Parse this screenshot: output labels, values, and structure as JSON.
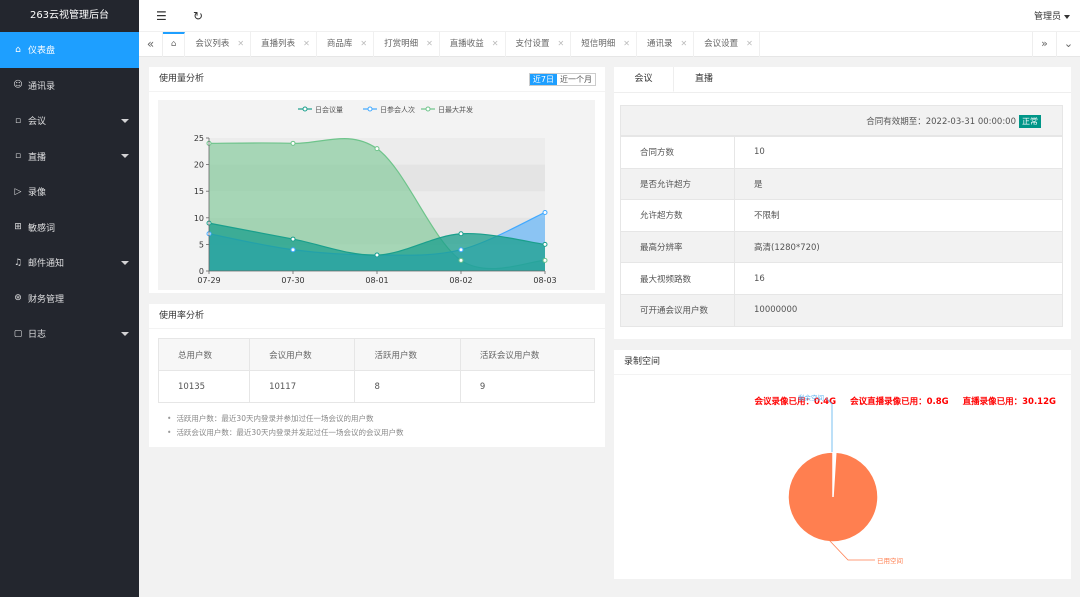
{
  "app": {
    "title": "263云视管理后台"
  },
  "sidebar": {
    "items": [
      {
        "label": "仪表盘",
        "icon": "home-icon"
      },
      {
        "label": "通讯录",
        "icon": "contacts-icon"
      },
      {
        "label": "会议",
        "icon": "meeting-icon"
      },
      {
        "label": "直播",
        "icon": "live-icon"
      },
      {
        "label": "录像",
        "icon": "video-icon"
      },
      {
        "label": "敏感词",
        "icon": "sensitive-icon"
      },
      {
        "label": "邮件通知",
        "icon": "bell-icon"
      },
      {
        "label": "财务管理",
        "icon": "finance-icon"
      },
      {
        "label": "日志",
        "icon": "log-icon"
      }
    ]
  },
  "header": {
    "user": "管理员"
  },
  "tabs": [
    "会议列表",
    "直播列表",
    "商品库",
    "打赏明细",
    "直播收益",
    "支付设置",
    "短信明细",
    "通讯录",
    "会议设置"
  ],
  "usage": {
    "title": "使用量分析",
    "ranges": [
      "近7日",
      "近一个月"
    ],
    "chart_data": {
      "type": "area",
      "categories": [
        "07-29",
        "07-30",
        "08-01",
        "08-02",
        "08-03"
      ],
      "ylim": [
        0,
        25
      ],
      "yticks": [
        "0",
        "5",
        "10",
        "15",
        "20",
        "25"
      ],
      "series": [
        {
          "name": "日会议量",
          "color": "#1a9f8c",
          "values": [
            9,
            6,
            3,
            7,
            5
          ]
        },
        {
          "name": "日参会人次",
          "color": "#41a9ff",
          "values": [
            7,
            4,
            3,
            4,
            11
          ]
        },
        {
          "name": "日最大并发",
          "color": "#6ec48b",
          "values": [
            24,
            24,
            23,
            2,
            2
          ]
        }
      ]
    }
  },
  "rate": {
    "title": "使用率分析",
    "headers": [
      "总用户数",
      "会议用户数",
      "活跃用户数",
      "活跃会议用户数"
    ],
    "values": [
      "10135",
      "10117",
      "8",
      "9"
    ],
    "notes": [
      "活跃用户数：最近30天内登录并参加过任一场会议的用户数",
      "活跃会议用户数：最近30天内登录并发起过任一场会议的会议用户数"
    ]
  },
  "meeting": {
    "tabs": [
      "会议",
      "直播"
    ],
    "contract_label": "合同有效期至：2022-03-31 00:00:00",
    "contract_status": "正常",
    "rows": [
      {
        "key": "合同方数",
        "value": "10"
      },
      {
        "key": "是否允许超方",
        "value": "是"
      },
      {
        "key": "允许超方数",
        "value": "不限制"
      },
      {
        "key": "最高分辨率",
        "value": "高清(1280*720)"
      },
      {
        "key": "最大视频路数",
        "value": "16"
      },
      {
        "key": "可开通会议用户数",
        "value": "10000000"
      }
    ]
  },
  "recording": {
    "title": "录制空间",
    "usage": [
      "会议录像已用：0.4G",
      "会议直播录像已用：0.8G",
      "直播录像已用：30.12G"
    ],
    "chart_data": {
      "type": "pie",
      "slices": [
        {
          "name": "剩余空间",
          "value": 1,
          "color": "#ffffff"
        },
        {
          "name": "已用空间",
          "value": 99,
          "color": "#ff7f50"
        }
      ],
      "label_colors": {
        "剩余空间": "#5ab1ef",
        "已用空间": "#ff7f50"
      }
    }
  }
}
